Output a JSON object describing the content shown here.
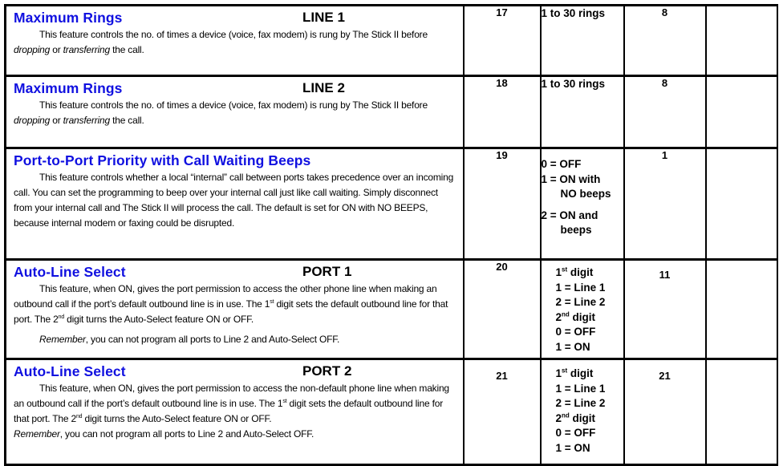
{
  "rows": [
    {
      "title": "Maximum Rings",
      "subtitle": "LINE 1",
      "desc_a": "This feature controls the no. of times a device (voice, fax modem) is rung by The Stick II before ",
      "desc_em1": "dropping",
      "desc_b": " or ",
      "desc_em2": "transferring",
      "desc_c": "  the call.",
      "location": "17",
      "range": [
        "1 to 30 rings"
      ],
      "default": "8",
      "setting": ""
    },
    {
      "title": "Maximum Rings",
      "subtitle": "LINE 2",
      "desc_a": "This feature controls the no. of times a device (voice, fax modem) is rung by The Stick II before ",
      "desc_em1": "dropping",
      "desc_b": " or ",
      "desc_em2": "transferring",
      "desc_c": "  the call.",
      "location": "18",
      "range": [
        "1 to 30 rings"
      ],
      "default": "8",
      "setting": ""
    },
    {
      "title": "Port-to-Port Priority with Call Waiting Beeps",
      "subtitle": "",
      "desc": "This feature controls whether a local “internal” call between ports takes precedence over an incoming call.  You can set the programming to beep over your internal call just like call waiting.  Simply disconnect from your internal call and The Stick II will process the call.  The default is set for ON with NO BEEPS, because internal modem or faxing could be disrupted.",
      "location": "19",
      "range": [
        "0 = OFF",
        "1  =  ON  with",
        "NO beeps",
        "2  =  ON  and",
        "beeps"
      ],
      "default": "1",
      "setting": ""
    },
    {
      "title": "Auto-Line Select",
      "subtitle": "PORT 1",
      "desc_a": "This feature, when ON, gives the port permission to access the other phone line when making an outbound call if the port’s default outbound line is in use.  The 1",
      "sup1": "st",
      "desc_b": " digit sets the default outbound line for that port.  The 2",
      "sup2": "nd",
      "desc_c": " digit turns the Auto-Select feature ON or OFF.",
      "remember_em": "Remember",
      "remember_text": ", you can not program all ports to Line 2 and Auto-Select OFF.",
      "location": "20",
      "range": [
        "1",
        "st",
        " digit",
        "1 = Line 1",
        "2 = Line 2",
        "2",
        "nd",
        " digit",
        "0 = OFF",
        "1 = ON"
      ],
      "default": "11",
      "setting": ""
    },
    {
      "title": "Auto-Line Select",
      "subtitle": "PORT 2",
      "desc_a": "This feature, when ON, gives the port permission to access the non-default phone line when making an outbound call if the port’s default outbound line is in use.  The 1",
      "sup1": "st",
      "desc_b": " digit sets the default outbound line for that port.  The 2",
      "sup2": "nd",
      "desc_c": " digit turns the Auto-Select feature ON or OFF.",
      "remember_em": "Remember",
      "remember_text": ", you can not program all ports to Line 2 and Auto-Select OFF.",
      "location": "21",
      "range": [
        "1",
        "st",
        " digit",
        "1 = Line 1",
        "2 = Line 2",
        "2",
        "nd",
        " digit",
        "0 = OFF",
        "1 = ON"
      ],
      "default": "21",
      "setting": ""
    }
  ],
  "colors": {
    "title_blue": "#1010e0",
    "border": "#000000"
  }
}
